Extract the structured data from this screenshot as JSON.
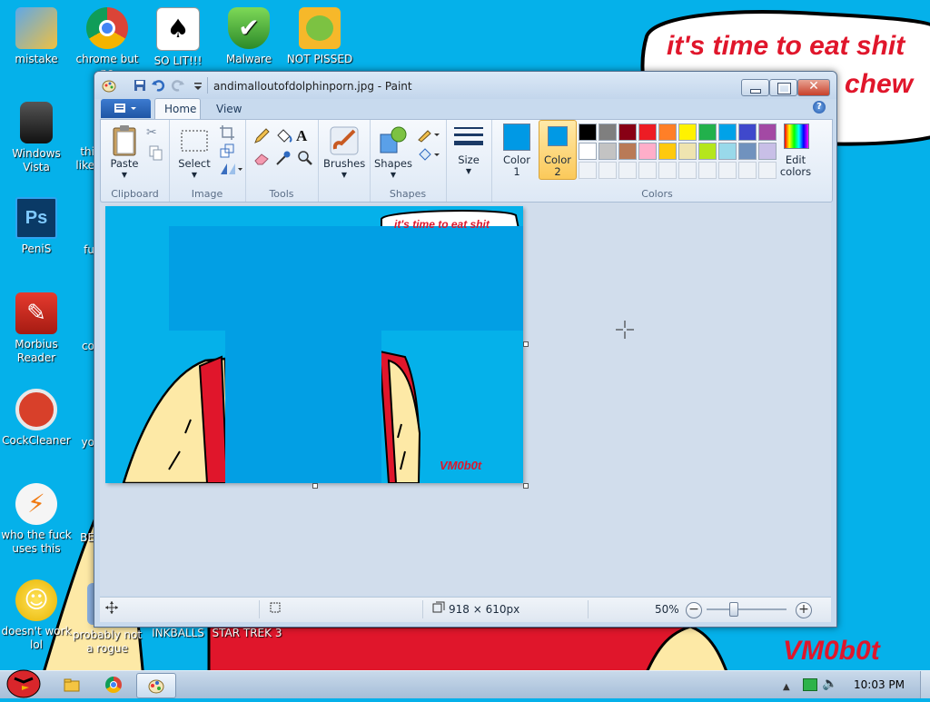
{
  "desktop": {
    "icons": [
      {
        "label": "mistake"
      },
      {
        "label": "chrome but no"
      },
      {
        "label": "SO LIT!!!"
      },
      {
        "label": "Malware"
      },
      {
        "label": "NOT PISSED"
      },
      {
        "label": "Windows Vista"
      },
      {
        "label": "PeniS"
      },
      {
        "label": "Morbius Reader"
      },
      {
        "label": "CockCleaner"
      },
      {
        "label": "who the fuck uses this"
      },
      {
        "label": "doesn't work lol"
      },
      {
        "label": "probably not a rogue"
      },
      {
        "label": "INKBALLS"
      },
      {
        "label": "STAR TREK 3"
      },
      {
        "label": "thi like"
      },
      {
        "label": "fu"
      },
      {
        "label": "co"
      },
      {
        "label": "yo"
      },
      {
        "label": "BE"
      }
    ],
    "wallpaper": {
      "bubble_line1": "it's time to eat shit",
      "bubble_line2": "chew",
      "watermark": "VM0b0t"
    },
    "colors": {
      "background": "#05b1ea",
      "accent_red": "#e0162b",
      "skin": "#fde9a6"
    }
  },
  "paint": {
    "title": "andimalloutofdolphinporn.jpg - Paint",
    "tabs": {
      "home": "Home",
      "view": "View"
    },
    "groups": {
      "clipboard": "Clipboard",
      "image": "Image",
      "tools": "Tools",
      "shapes": "Shapes",
      "colors": "Colors"
    },
    "buttons": {
      "paste": "Paste",
      "select": "Select",
      "brushes": "Brushes",
      "shapes": "Shapes",
      "size": "Size",
      "color1_line1": "Color",
      "color1_line2": "1",
      "color2_line1": "Color",
      "color2_line2": "2",
      "edit_colors_line1": "Edit",
      "edit_colors_line2": "colors"
    },
    "color1": "#0099e5",
    "color2": "#0099e5",
    "palette_row1": [
      "#000000",
      "#7f7f7f",
      "#880015",
      "#ed1c24",
      "#ff7f27",
      "#fff200",
      "#22b14c",
      "#00a2e8",
      "#3f48cc",
      "#a349a4"
    ],
    "palette_row2": [
      "#ffffff",
      "#c3c3c3",
      "#b97a57",
      "#ffaec9",
      "#ffc90e",
      "#efe4b0",
      "#b5e61d",
      "#99d9ea",
      "#7092be",
      "#c8bfe7"
    ],
    "canvas": {
      "bubble_text": "it's time to eat shit",
      "watermark": "VM0b0t"
    },
    "status": {
      "image_size": "918 × 610px",
      "zoom": "50%",
      "zoom_level": 0.5
    }
  },
  "taskbar": {
    "clock": "10:03 PM"
  }
}
